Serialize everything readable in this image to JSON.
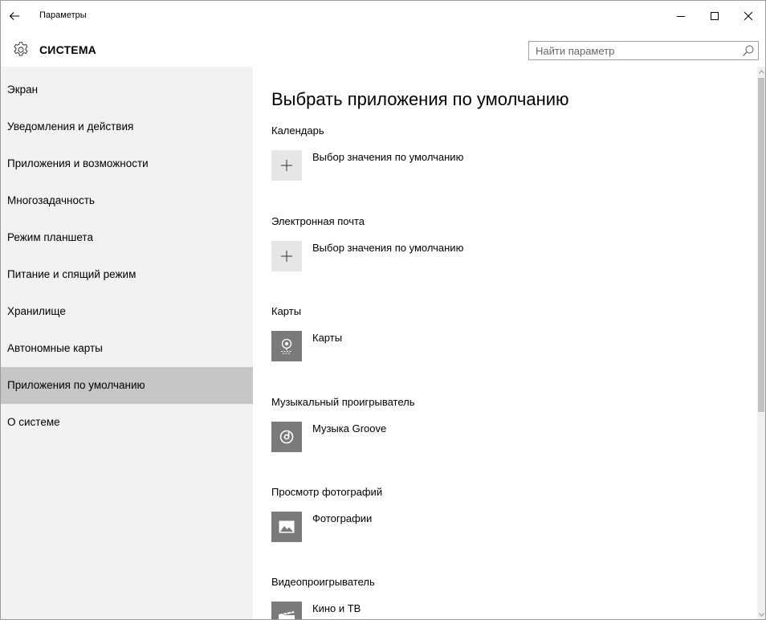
{
  "window": {
    "title": "Параметры",
    "back_icon": "arrow-left-icon",
    "minimize_icon": "minimize-icon",
    "maximize_icon": "maximize-icon",
    "close_icon": "close-icon"
  },
  "header": {
    "section_icon": "gear-icon",
    "title": "СИСТЕМА",
    "search": {
      "placeholder": "Найти параметр",
      "value": "",
      "icon": "search-icon"
    }
  },
  "sidebar": {
    "active_index": 8,
    "items": [
      {
        "label": "Экран"
      },
      {
        "label": "Уведомления и действия"
      },
      {
        "label": "Приложения и возможности"
      },
      {
        "label": "Многозадачность"
      },
      {
        "label": "Режим планшета"
      },
      {
        "label": "Питание и спящий режим"
      },
      {
        "label": "Хранилище"
      },
      {
        "label": "Автономные карты"
      },
      {
        "label": "Приложения по умолчанию"
      },
      {
        "label": "О системе"
      }
    ]
  },
  "main": {
    "title": "Выбрать приложения по умолчанию",
    "sections": [
      {
        "label": "Календарь",
        "app": "Выбор значения по умолчанию",
        "icon": "plus-icon"
      },
      {
        "label": "Электронная почта",
        "app": "Выбор значения по умолчанию",
        "icon": "plus-icon"
      },
      {
        "label": "Карты",
        "app": "Карты",
        "icon": "maps-icon"
      },
      {
        "label": "Музыкальный проигрыватель",
        "app": "Музыка Groove",
        "icon": "groove-music-icon"
      },
      {
        "label": "Просмотр фотографий",
        "app": "Фотографии",
        "icon": "photos-icon"
      },
      {
        "label": "Видеопроигрыватель",
        "app": "Кино и ТВ",
        "icon": "movies-tv-icon"
      }
    ]
  },
  "colors": {
    "sidebar_bg": "#f2f2f2",
    "sidebar_active_bg": "#c6c6c6",
    "app_icon_bg": "#7a7a7a",
    "plus_tile_bg": "#e6e6e6",
    "scrollbar_thumb": "#c2c2c2"
  }
}
